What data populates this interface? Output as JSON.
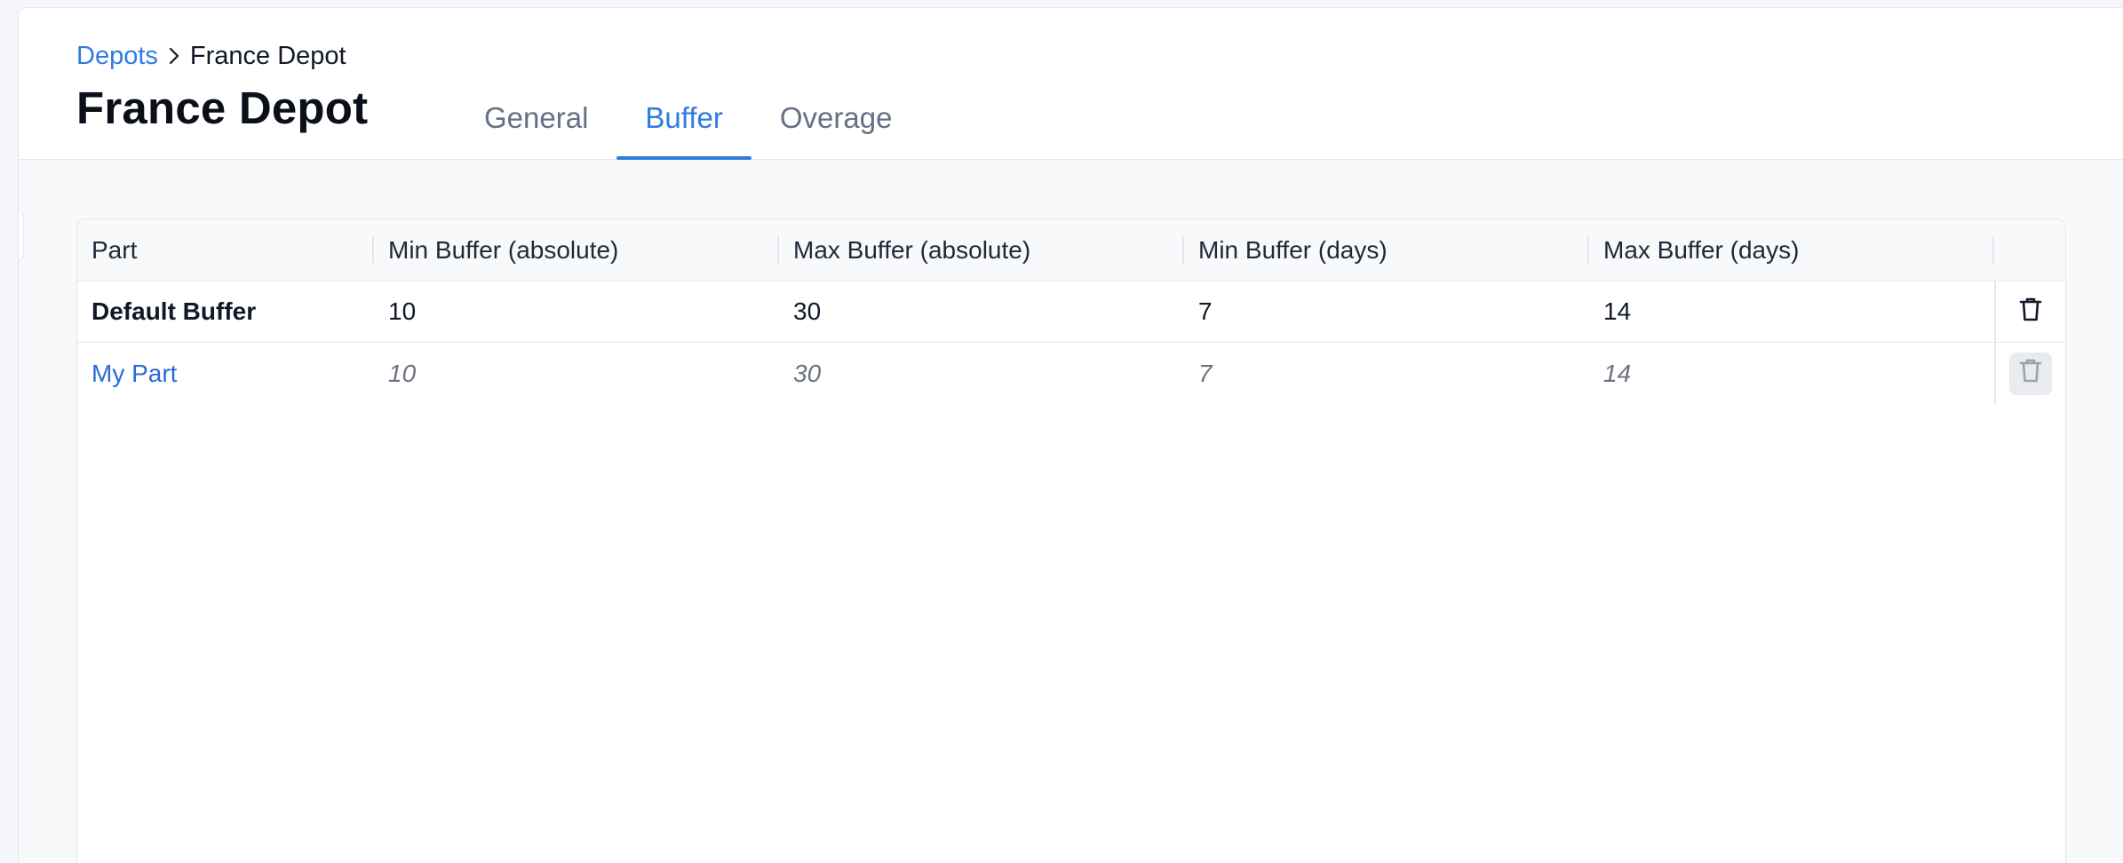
{
  "breadcrumb": {
    "parent_label": "Depots",
    "current_label": "France Depot"
  },
  "page": {
    "title": "France Depot"
  },
  "tabs": [
    {
      "label": "General",
      "active": false
    },
    {
      "label": "Buffer",
      "active": true
    },
    {
      "label": "Overage",
      "active": false
    }
  ],
  "table": {
    "columns": [
      "Part",
      "Min Buffer (absolute)",
      "Max Buffer (absolute)",
      "Min Buffer (days)",
      "Max Buffer (days)"
    ],
    "rows": [
      {
        "part": "Default Buffer",
        "min_abs": "10",
        "max_abs": "30",
        "min_days": "7",
        "max_days": "14",
        "delete_enabled": true
      },
      {
        "part": "My Part",
        "min_abs": "10",
        "max_abs": "30",
        "min_days": "7",
        "max_days": "14",
        "delete_enabled": false
      }
    ]
  },
  "icons": {
    "breadcrumb_separator": "chevron-right-icon",
    "row_action": "trash-icon"
  },
  "colors": {
    "accent": "#2f7be0",
    "link": "#2a6ad6",
    "muted_text": "#6b7280"
  }
}
